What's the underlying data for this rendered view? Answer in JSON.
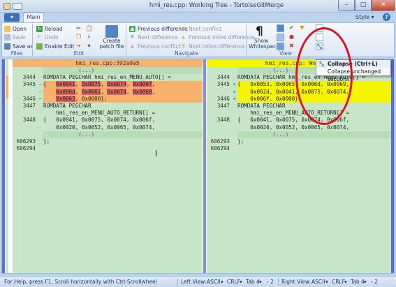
{
  "window": {
    "title": "hmi_res.cpp: Working Tree - TortoiseGitMerge"
  },
  "tabs": {
    "main": "Main",
    "style": "Style ▾",
    "help": "?"
  },
  "ribbon": {
    "files": {
      "label": "Files",
      "open": "Open",
      "save": "Save",
      "save_as": "Save as"
    },
    "edit": {
      "label": "Edit",
      "reload": "Reload",
      "undo": "Undo",
      "enable_edit": "Enable Edit",
      "create_patch": "Create",
      "create_patch2": "patch file"
    },
    "navigate": {
      "label": "Navigate",
      "prev_diff": "Previous difference",
      "next_diff": "Next difference",
      "prev_conflict": "Previous conflict",
      "next_conflict": "Next conflict",
      "prev_inline": "Previous inline difference",
      "next_inline": "Next inline difference"
    },
    "view": {
      "label": "View",
      "show": "Show",
      "whitespaces": "Whitespaces"
    }
  },
  "popup": {
    "collapse": "Collapse (Ctrl+L)",
    "collapse_unchanged": "Collapse unchanged sections"
  },
  "left_pane": {
    "header": "hmi_res.cpp:392a9a5",
    "rows": [
      {
        "num": "",
        "marker": "",
        "text": "           (...)",
        "kind": "fold"
      },
      {
        "num": "3444",
        "marker": "",
        "text": "ROMDATA PEGCHAR hmi_res_en_MENU_AUTO[] =",
        "kind": "normal"
      },
      {
        "num": "3445",
        "marker": "−",
        "text": "{   0x0041, 0x0075, 0x0074, 0x006f,",
        "kind": "removed"
      },
      {
        "num": "",
        "marker": "−",
        "text": "    0x006d, 0x0061, 0x0074, 0x0069,",
        "kind": "removed"
      },
      {
        "num": "3446",
        "marker": "−",
        "text": "    0x0063, 0x0000};",
        "kind": "removed"
      },
      {
        "num": "3447",
        "marker": "",
        "text": "ROMDATA PEGCHAR",
        "kind": "normal"
      },
      {
        "num": "",
        "marker": "",
        "text": "    hmi_res_en_MENU_AUTO_RETURN[] =",
        "kind": "normal"
      },
      {
        "num": "3448",
        "marker": "",
        "text": "{   0x0041, 0x0075, 0x0074, 0x006f,",
        "kind": "normal"
      },
      {
        "num": "",
        "marker": "",
        "text": "    0x0020, 0x0052, 0x0065, 0x0074,",
        "kind": "normal"
      },
      {
        "num": "",
        "marker": "",
        "text": "           (...)",
        "kind": "fold"
      },
      {
        "num": "606293",
        "marker": "",
        "text": "};",
        "kind": "normal"
      },
      {
        "num": "606294",
        "marker": "",
        "text": "",
        "kind": "normal"
      }
    ]
  },
  "right_pane": {
    "header": "hmi_res.cpp: Working",
    "rows": [
      {
        "num": "",
        "marker": "",
        "text": "           (...)",
        "kind": "fold"
      },
      {
        "num": "3444",
        "marker": "",
        "text": "ROMDATA PEGCHAR hmi_res_en_MENU_AUTO[] =",
        "kind": "normal"
      },
      {
        "num": "3445",
        "marker": "+",
        "text": "{   0x0053, 0x0065, 0x006d, 0x0069,",
        "kind": "added"
      },
      {
        "num": "",
        "marker": "+",
        "text": "    0x002d, 0x0041, 0x0075, 0x0074,",
        "kind": "added"
      },
      {
        "num": "3446",
        "marker": "+",
        "text": "    0x006f, 0x0000};",
        "kind": "added"
      },
      {
        "num": "3447",
        "marker": "",
        "text": "ROMDATA PEGCHAR",
        "kind": "normal"
      },
      {
        "num": "",
        "marker": "",
        "text": "    hmi_res_en_MENU_AUTO_RETURN[] =",
        "kind": "normal"
      },
      {
        "num": "3448",
        "marker": "",
        "text": "{   0x0041, 0x0075, 0x0074, 0x006f,",
        "kind": "normal"
      },
      {
        "num": "",
        "marker": "",
        "text": "    0x0020, 0x0052, 0x0065, 0x0074,",
        "kind": "normal"
      },
      {
        "num": "",
        "marker": "",
        "text": "           (...)",
        "kind": "fold"
      },
      {
        "num": "606293",
        "marker": "",
        "text": "};",
        "kind": "normal"
      },
      {
        "num": "606294",
        "marker": "",
        "text": "",
        "kind": "normal"
      }
    ]
  },
  "status": {
    "help": "For Help, press F1. Scroll horizontally with Ctrl-Scrollwheel",
    "left_view": "Left View:",
    "right_view": "Right View:",
    "encoding": "ASCII",
    "eol": "CRLF",
    "tab": "Tab 4",
    "diff": "- 2"
  },
  "colors": {
    "removed": "#f6b26b",
    "added": "#f5f500",
    "normal": "#c7e6c7",
    "word_removed": "#e06666"
  }
}
